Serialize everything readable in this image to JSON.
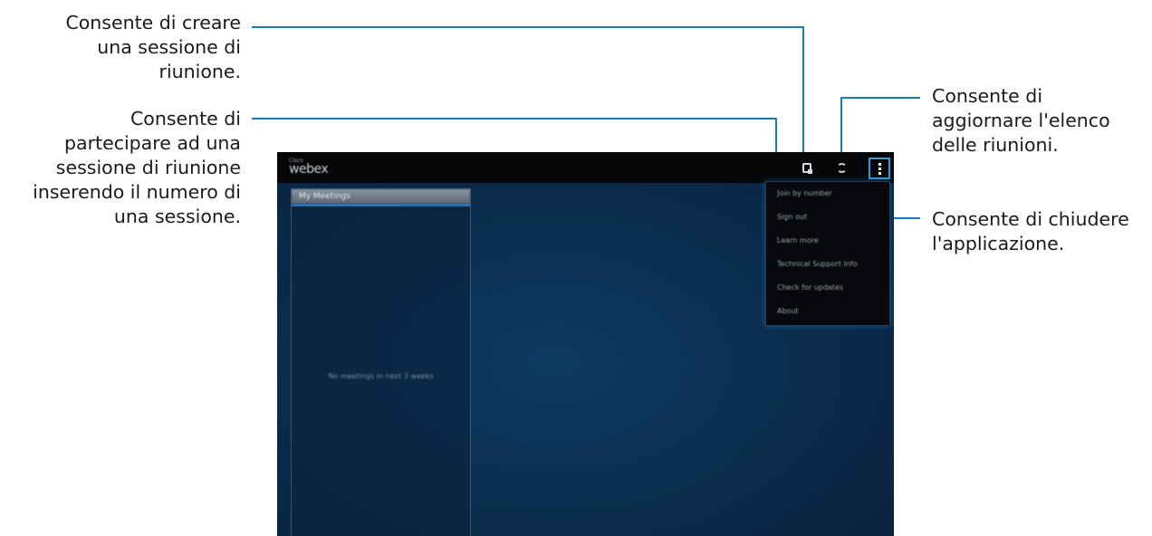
{
  "callouts": {
    "create": [
      "Consente di creare",
      "una sessione di",
      "riunione."
    ],
    "join": [
      "Consente di",
      "partecipare ad una",
      "sessione di riunione",
      "inserendo il numero di",
      "una sessione."
    ],
    "refresh": [
      "Consente di",
      "aggiornare l'elenco",
      "delle riunioni."
    ],
    "close": [
      "Consente di chiudere",
      "l'applicazione."
    ]
  },
  "app": {
    "brand_small": "Cisco",
    "brand": "webex",
    "icons": {
      "create": "create-meeting-icon",
      "refresh": "refresh-icon",
      "menu": "overflow-menu-icon"
    },
    "panel": {
      "title": "My Meetings",
      "empty_text": "No meetings in next 3 weeks"
    },
    "menu_items": [
      "Join by number",
      "Sign out",
      "Learn more",
      "Technical Support Info",
      "Check for updates",
      "About"
    ]
  },
  "colors": {
    "callout_line": "#1c7cb0",
    "highlight": "#2aa0e0",
    "screen_bg": "#0b2c4c",
    "topbar": "#050608"
  }
}
